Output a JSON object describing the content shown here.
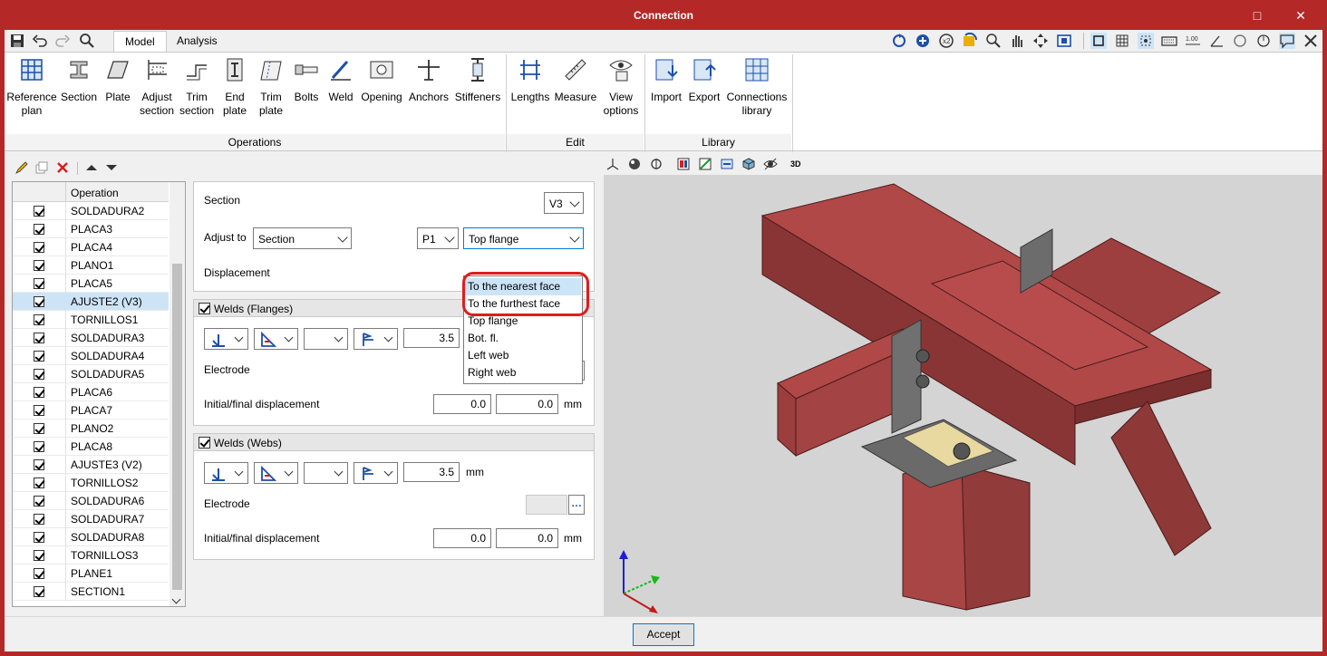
{
  "window": {
    "title": "Connection"
  },
  "tabs": [
    {
      "label": "Model",
      "active": true
    },
    {
      "label": "Analysis",
      "active": false
    }
  ],
  "ribbon": {
    "groups": [
      {
        "label": "Operations"
      },
      {
        "label": "Edit"
      },
      {
        "label": "Library"
      }
    ],
    "buttons": [
      {
        "line1": "Reference",
        "line2": "plan"
      },
      {
        "line1": "Section",
        "line2": ""
      },
      {
        "line1": "Plate",
        "line2": ""
      },
      {
        "line1": "Adjust",
        "line2": "section"
      },
      {
        "line1": "Trim",
        "line2": "section"
      },
      {
        "line1": "End",
        "line2": "plate"
      },
      {
        "line1": "Trim",
        "line2": "plate"
      },
      {
        "line1": "Bolts",
        "line2": ""
      },
      {
        "line1": "Weld",
        "line2": ""
      },
      {
        "line1": "Opening",
        "line2": ""
      },
      {
        "line1": "Anchors",
        "line2": ""
      },
      {
        "line1": "Stiffeners",
        "line2": ""
      },
      {
        "line1": "Lengths",
        "line2": ""
      },
      {
        "line1": "Measure",
        "line2": ""
      },
      {
        "line1": "View",
        "line2": "options"
      },
      {
        "line1": "Import",
        "line2": ""
      },
      {
        "line1": "Export",
        "line2": ""
      },
      {
        "line1": "Connections",
        "line2": "library"
      }
    ]
  },
  "operations": {
    "header": "Operation",
    "items": [
      "SOLDADURA2",
      "PLACA3",
      "PLACA4",
      "PLANO1",
      "PLACA5",
      "AJUSTE2 (V3)",
      "TORNILLOS1",
      "SOLDADURA3",
      "SOLDADURA4",
      "SOLDADURA5",
      "PLACA6",
      "PLACA7",
      "PLANO2",
      "PLACA8",
      "AJUSTE3 (V2)",
      "TORNILLOS2",
      "SOLDADURA6",
      "SOLDADURA7",
      "SOLDADURA8",
      "TORNILLOS3",
      "PLANE1",
      "SECTION1"
    ],
    "selected_index": 5
  },
  "form": {
    "section_label": "Section",
    "section_value": "V3",
    "adjust_label": "Adjust to",
    "adjust_value": "Section",
    "point_value": "P1",
    "face_value": "Top flange",
    "displacement_label": "Displacement",
    "face_options": [
      "To the nearest face",
      "To the furthest face",
      "Top flange",
      "Bot. fl.",
      "Left web",
      "Right web"
    ],
    "welds_flanges": {
      "title": "Welds (Flanges)",
      "size": "3.5",
      "electrode_label": "Electrode",
      "disp_label": "Initial/final displacement",
      "disp_initial": "0.0",
      "disp_final": "0.0",
      "unit": "mm"
    },
    "welds_webs": {
      "title": "Welds (Webs)",
      "size": "3.5",
      "size_unit": "mm",
      "electrode_label": "Electrode",
      "disp_label": "Initial/final displacement",
      "disp_initial": "0.0",
      "disp_final": "0.0",
      "unit": "mm"
    }
  },
  "view_toolbar": {
    "label_3d": "3D"
  },
  "footer": {
    "accept_label": "Accept"
  },
  "colors": {
    "frame": "#b52828",
    "steel": "#b04848",
    "highlight": "#e01c1c"
  }
}
